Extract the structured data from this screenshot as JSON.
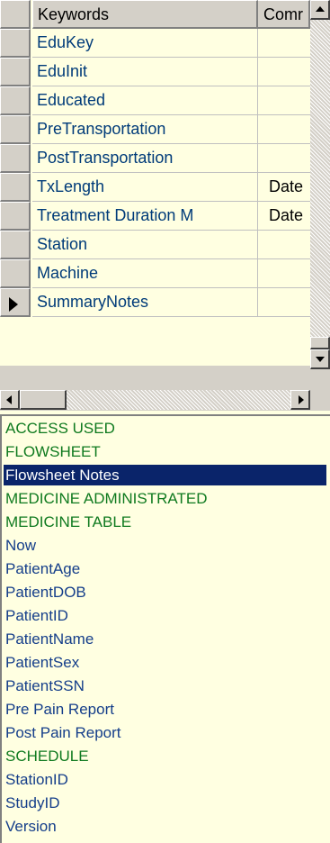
{
  "grid": {
    "columns": [
      "Keywords",
      "Comr"
    ],
    "rows": [
      {
        "keyword": "EduKey",
        "comment": ""
      },
      {
        "keyword": "EduInit",
        "comment": ""
      },
      {
        "keyword": "Educated",
        "comment": ""
      },
      {
        "keyword": "PreTransportation",
        "comment": ""
      },
      {
        "keyword": "PostTransportation",
        "comment": ""
      },
      {
        "keyword": "TxLength",
        "comment": "Date"
      },
      {
        "keyword": "Treatment Duration M",
        "comment": "Date"
      },
      {
        "keyword": "Station",
        "comment": ""
      },
      {
        "keyword": "Machine",
        "comment": ""
      },
      {
        "keyword": "SummaryNotes",
        "comment": ""
      }
    ],
    "current_row_index": 9
  },
  "list": {
    "items": [
      "ACCESS USED",
      "FLOWSHEET",
      "Flowsheet Notes",
      "MEDICINE ADMINISTRATED",
      "MEDICINE TABLE",
      "Now",
      "PatientAge",
      "PatientDOB",
      "PatientID",
      "PatientName",
      "PatientSex",
      "PatientSSN",
      "Pre Pain Report",
      "Post Pain Report",
      "SCHEDULE",
      "StationID",
      "StudyID",
      "Version"
    ],
    "selected_index": 2
  },
  "colors": {
    "background": "#ffffe1",
    "selection": "#0a246a",
    "uppercase_text": "#0f7a1f",
    "mixedcase_text": "#153e8a",
    "chrome": "#d4d0c8"
  }
}
